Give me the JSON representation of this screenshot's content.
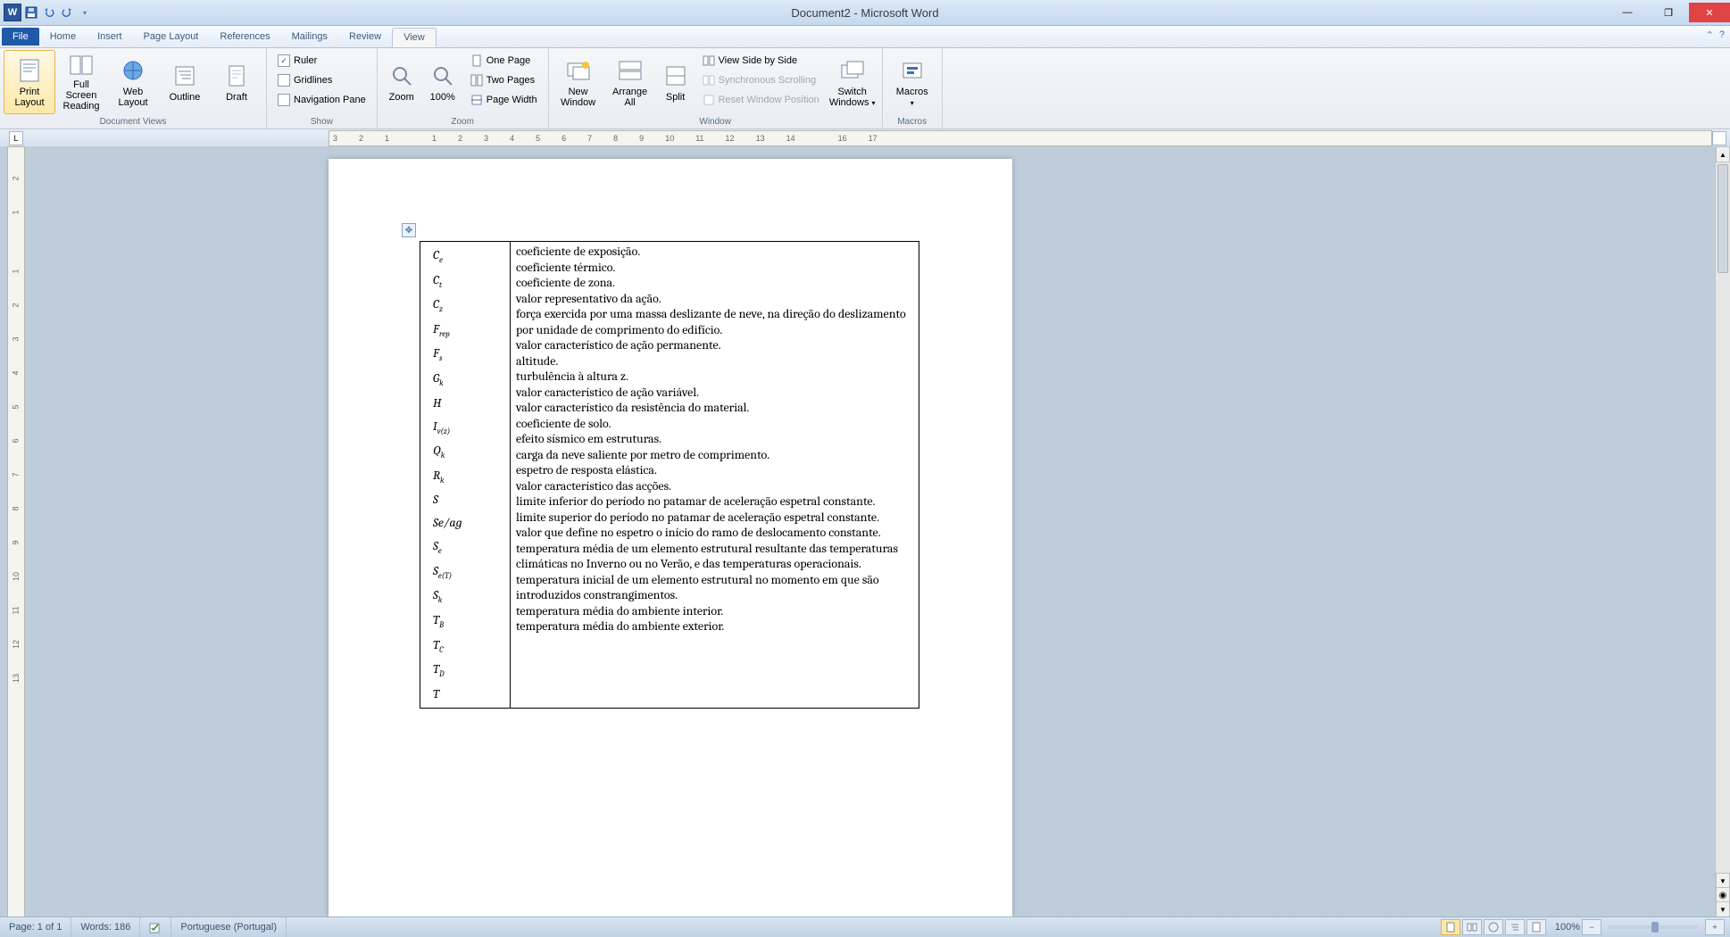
{
  "title": "Document2 - Microsoft Word",
  "tabs": {
    "file": "File",
    "home": "Home",
    "insert": "Insert",
    "pagelayout": "Page Layout",
    "references": "References",
    "mailings": "Mailings",
    "review": "Review",
    "view": "View"
  },
  "ribbon": {
    "docviews": {
      "print": "Print Layout",
      "full": "Full Screen Reading",
      "web": "Web Layout",
      "outline": "Outline",
      "draft": "Draft",
      "label": "Document Views"
    },
    "show": {
      "ruler": "Ruler",
      "grid": "Gridlines",
      "nav": "Navigation Pane",
      "label": "Show"
    },
    "zoom": {
      "zoom": "Zoom",
      "p100": "100%",
      "one": "One Page",
      "two": "Two Pages",
      "pw": "Page Width",
      "label": "Zoom"
    },
    "window": {
      "new": "New Window",
      "arrange": "Arrange All",
      "split": "Split",
      "side": "View Side by Side",
      "sync": "Synchronous Scrolling",
      "reset": "Reset Window Position",
      "switch": "Switch Windows",
      "label": "Window"
    },
    "macros": {
      "macros": "Macros",
      "label": "Macros"
    }
  },
  "ruler_h": [
    "3",
    "2",
    "1",
    "",
    "1",
    "2",
    "3",
    "4",
    "5",
    "6",
    "7",
    "8",
    "9",
    "10",
    "11",
    "12",
    "13",
    "14",
    "",
    "16",
    "17"
  ],
  "ruler_v": [
    "2",
    "1",
    "",
    "1",
    "2",
    "3",
    "4",
    "5",
    "6",
    "7",
    "8",
    "9",
    "10",
    "11",
    "12",
    "13"
  ],
  "symbols": [
    "C_e",
    "C_t",
    "C_z",
    "F_rep",
    "F_s",
    "G_k",
    "H",
    "I_v(z)",
    "Q_k",
    "R_k",
    "S",
    "Se/ag",
    "S_e",
    "S_e(T)",
    "S_k",
    "T_B",
    "T_C",
    "T_D",
    "T"
  ],
  "defs": [
    "coeficiente de exposição.",
    "coeficiente térmico.",
    "coeficiente de zona.",
    "valor representativo da ação.",
    "força exercida por uma massa deslizante de neve, na direção do deslizamento por unidade de comprimento do edifício.",
    "valor característico de ação permanente.",
    "altitude.",
    "turbulência à altura z.",
    "valor característico de ação variável.",
    "valor característico da resistência do material.",
    "coeficiente de solo.",
    "efeito sísmico em estruturas.",
    "carga da neve saliente por metro de comprimento.",
    "espetro de resposta elástica.",
    "valor característico das acções.",
    "limite inferior do período no patamar de aceleração espetral constante.",
    "limite superior do período no patamar de aceleração espetral constante.",
    "valor que define no espetro o início do ramo de deslocamento constante.",
    "temperatura média de um elemento estrutural resultante das temperaturas climáticas no Inverno ou no Verão, e das temperaturas operacionais.",
    "temperatura inicial de um elemento estrutural no momento em que são introduzidos constrangimentos.",
    "temperatura média do ambiente interior.",
    "temperatura média do ambiente exterior."
  ],
  "status": {
    "page": "Page: 1 of 1",
    "words": "Words: 186",
    "lang": "Portuguese (Portugal)",
    "zoom": "100%"
  }
}
